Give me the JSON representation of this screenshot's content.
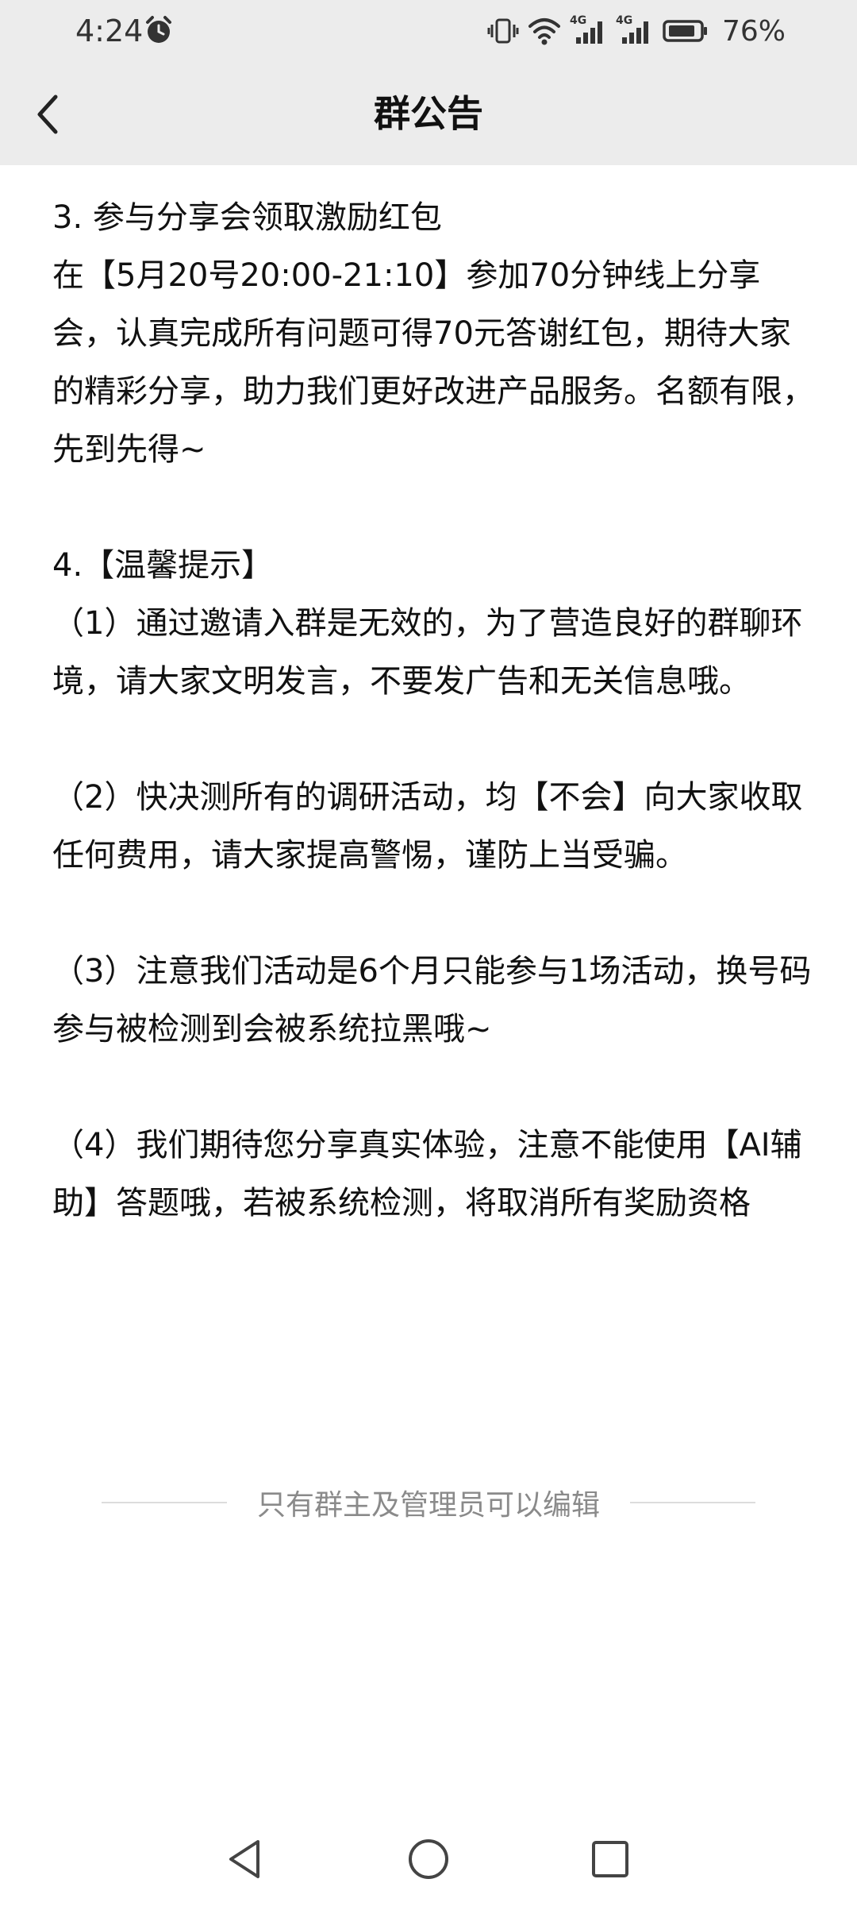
{
  "status_bar": {
    "time": "4:24",
    "alarm_icon": "alarm-clock-icon",
    "vibrate_icon": "vibrate-icon",
    "wifi_icon": "wifi-icon",
    "signal_1_label": "4G",
    "signal_2_label": "4G",
    "battery_icon": "battery-icon",
    "battery_level": "76%"
  },
  "header": {
    "back_icon": "chevron-left-icon",
    "title": "群公告"
  },
  "announcement": {
    "paragraphs": [
      "3. 参与分享会领取激励红包\n在【5月20号20:00-21:10】参加70分钟线上分享会，认真完成所有问题可得70元答谢红包，期待大家的精彩分享，助力我们更好改进产品服务。名额有限，先到先得~",
      "4.【温馨提示】\n（1）通过邀请入群是无效的，为了营造良好的群聊环境，请大家文明发言，不要发广告和无关信息哦。",
      "（2）快决测所有的调研活动，均【不会】向大家收取任何费用，请大家提高警惕，谨防上当受骗。",
      "（3）注意我们活动是6个月只能参与1场活动，换号码参与被检测到会被系统拉黑哦~",
      "（4）我们期待您分享真实体验，注意不能使用【AI辅助】答题哦，若被系统检测，将取消所有奖励资格"
    ]
  },
  "footer": {
    "edit_note": "只有群主及管理员可以编辑"
  },
  "nav_bar": {
    "back_icon": "triangle-back-icon",
    "home_icon": "circle-home-icon",
    "recents_icon": "square-recents-icon"
  },
  "colors": {
    "header_bg": "#ececec",
    "page_bg": "#ffffff",
    "text": "#111111",
    "muted_text": "#8a8a8a"
  }
}
